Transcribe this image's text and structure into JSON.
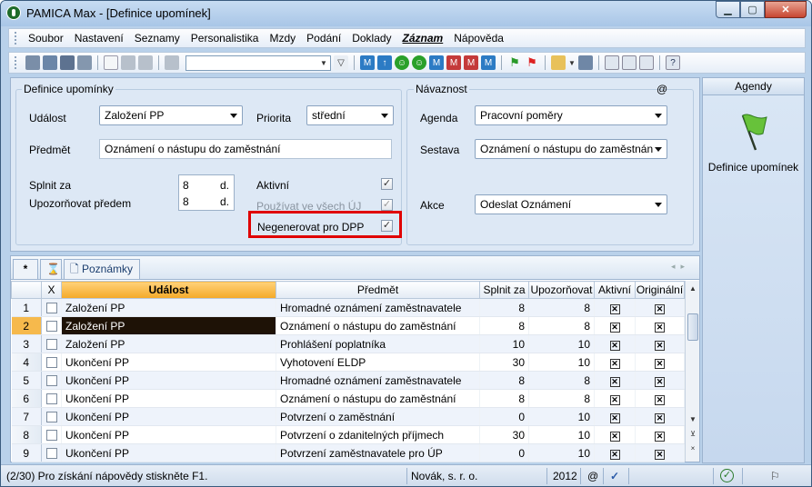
{
  "window": {
    "title": "PAMICA Max - [Definice upomínek]"
  },
  "menu": [
    "Soubor",
    "Nastavení",
    "Seznamy",
    "Personalistika",
    "Mzdy",
    "Podání",
    "Doklady",
    "Záznam",
    "Nápověda"
  ],
  "form": {
    "group_title": "Definice upomínky",
    "udalost_label": "Událost",
    "udalost_value": "Založení PP",
    "priorita_label": "Priorita",
    "priorita_value": "střední",
    "predmet_label": "Předmět",
    "predmet_value": "Oznámení o nástupu do zaměstnání",
    "splnit_label": "Splnit za",
    "splnit_value": "8",
    "splnit_unit": "d.",
    "upozornovat_label": "Upozorňovat předem",
    "upozornovat_value": "8",
    "upozornovat_unit": "d.",
    "aktivni_label": "Aktivní",
    "aktivni_checked": "✓",
    "pouzivat_label": "Používat ve všech ÚJ",
    "pouzivat_checked": "✓",
    "negenerovat_label": "Negenerovat pro DPP",
    "negenerovat_checked": "✓"
  },
  "navaznost": {
    "group_title": "Návaznost",
    "at": "@",
    "agenda_label": "Agenda",
    "agenda_value": "Pracovní poměry",
    "sestava_label": "Sestava",
    "sestava_value": "Oznámení o nástupu do zaměstnán",
    "akce_label": "Akce",
    "akce_value": "Odeslat Oznámení"
  },
  "agendy": {
    "header": "Agendy",
    "item_label": "Definice upomínek"
  },
  "tabs": {
    "star": "*",
    "notes_label": "Poznámky"
  },
  "grid": {
    "columns": [
      "",
      "X",
      "Událost",
      "Předmět",
      "Splnit za",
      "Upozorňovat",
      "Aktivní",
      "Originální"
    ],
    "rows": [
      {
        "n": "1",
        "ev": "Založení PP",
        "subj": "Hromadné oznámení zaměstnavatele",
        "splnit": "8",
        "upoz": "8"
      },
      {
        "n": "2",
        "ev": "Založení PP",
        "subj": "Oznámení o nástupu do zaměstnání",
        "splnit": "8",
        "upoz": "8"
      },
      {
        "n": "3",
        "ev": "Založení PP",
        "subj": "Prohlášení poplatníka",
        "splnit": "10",
        "upoz": "10"
      },
      {
        "n": "4",
        "ev": "Ukončení PP",
        "subj": "Vyhotovení ELDP",
        "splnit": "30",
        "upoz": "10"
      },
      {
        "n": "5",
        "ev": "Ukončení PP",
        "subj": "Hromadné oznámení zaměstnavatele",
        "splnit": "8",
        "upoz": "8"
      },
      {
        "n": "6",
        "ev": "Ukončení PP",
        "subj": "Oznámení o nástupu do zaměstnání",
        "splnit": "8",
        "upoz": "8"
      },
      {
        "n": "7",
        "ev": "Ukončení PP",
        "subj": "Potvrzení o zaměstnání",
        "splnit": "0",
        "upoz": "10"
      },
      {
        "n": "8",
        "ev": "Ukončení PP",
        "subj": "Potvrzení o zdanitelných příjmech",
        "splnit": "30",
        "upoz": "10"
      },
      {
        "n": "9",
        "ev": "Ukončení PP",
        "subj": "Potvrzení zaměstnavatele pro ÚP",
        "splnit": "0",
        "upoz": "10"
      }
    ],
    "check_glyph": "✕"
  },
  "status": {
    "hint": "(2/30) Pro získání nápovědy stiskněte F1.",
    "company": "Novák, s. r. o.",
    "year": "2012",
    "at": "@"
  },
  "colors": {
    "highlight": "#e00000",
    "sorted_header": "#f4a927",
    "current_row": "#1e1206"
  }
}
